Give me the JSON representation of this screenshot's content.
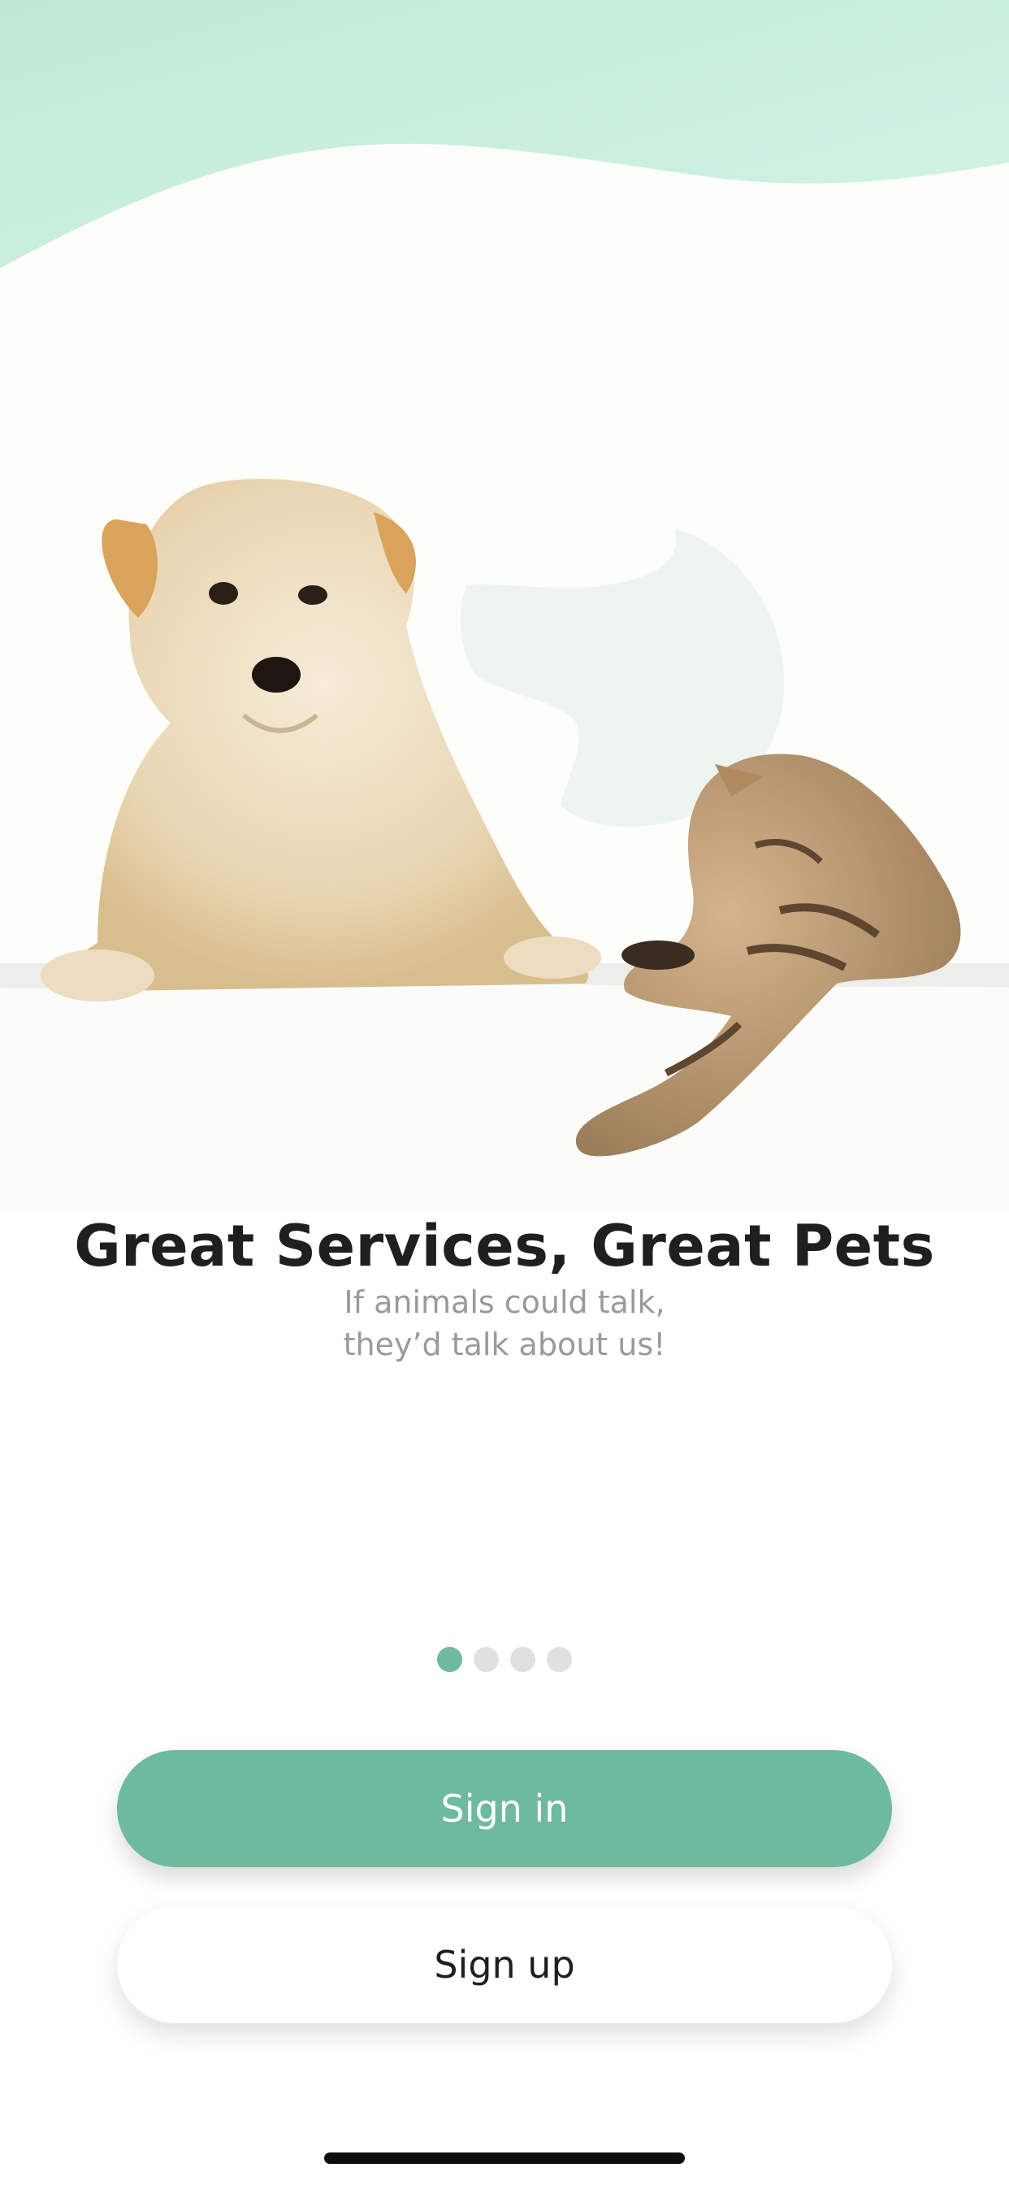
{
  "onboarding": {
    "title": "Great Services, Great Pets",
    "subtitle_line1": "If animals could talk,",
    "subtitle_line2": "they’d talk about us!",
    "hero_image": "dog-and-cat-photo",
    "pagination": {
      "total": 4,
      "active_index": 0
    }
  },
  "actions": {
    "sign_in_label": "Sign in",
    "sign_up_label": "Sign up"
  },
  "colors": {
    "accent": "#6dba9c",
    "wave": "#cdf1e1",
    "background": "#fdfdf9",
    "title": "#1f1f1f",
    "subtitle": "#9a9a9a",
    "dot_inactive": "#e0e0e0"
  }
}
